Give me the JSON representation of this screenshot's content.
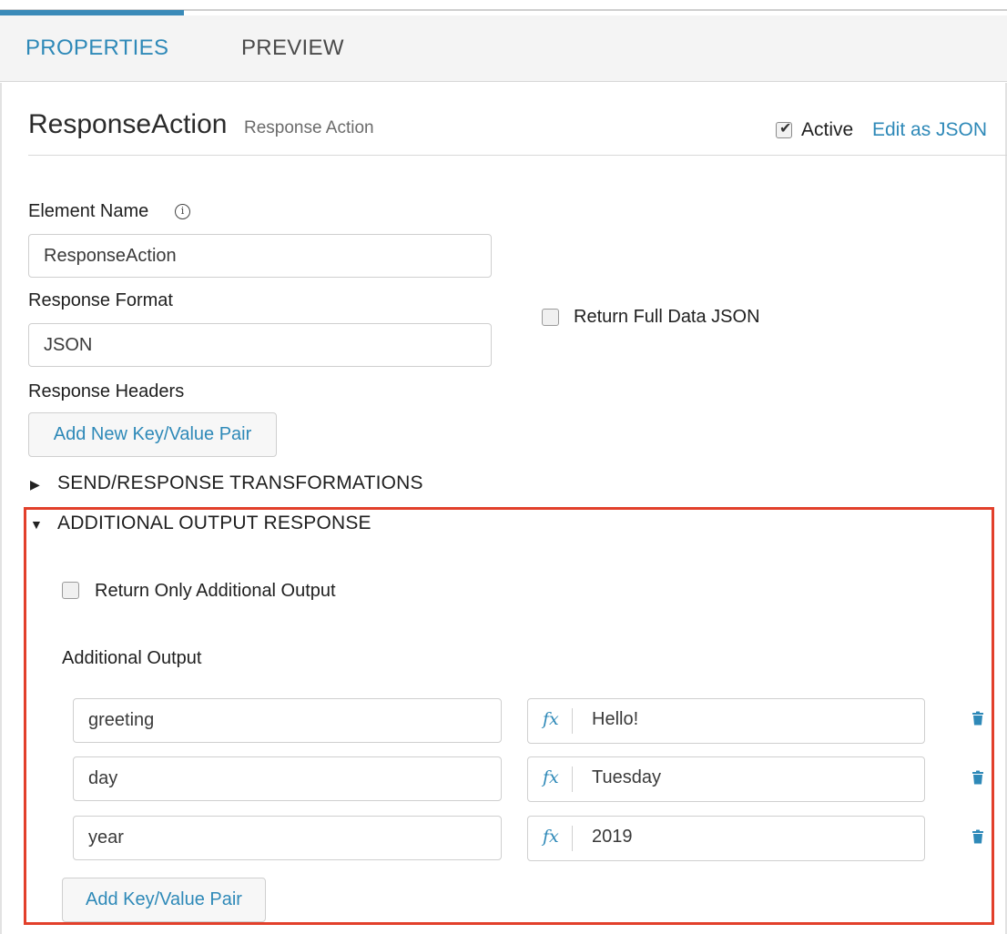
{
  "tabs": [
    {
      "label": "PROPERTIES",
      "active": true
    },
    {
      "label": "PREVIEW",
      "active": false
    }
  ],
  "header": {
    "title": "ResponseAction",
    "subtitle": "Response Action",
    "active_label": "Active",
    "active_checked": true,
    "edit_json_label": "Edit as JSON"
  },
  "form": {
    "element_name_label": "Element Name",
    "element_name_value": "ResponseAction",
    "response_format_label": "Response Format",
    "response_format_value": "JSON",
    "return_full_data_label": "Return Full Data JSON",
    "response_headers_label": "Response Headers",
    "add_new_pair_label": "Add New Key/Value Pair"
  },
  "sections": {
    "send_response_label": "SEND/RESPONSE TRANSFORMATIONS",
    "additional_output_response_label": "ADDITIONAL OUTPUT RESPONSE"
  },
  "additional": {
    "return_only_label": "Return Only Additional Output",
    "output_label": "Additional Output",
    "rows": [
      {
        "key": "greeting",
        "fx": "fx",
        "value": "Hello!"
      },
      {
        "key": "day",
        "fx": "fx",
        "value": "Tuesday"
      },
      {
        "key": "year",
        "fx": "fx",
        "value": "2019"
      }
    ],
    "add_pair_label": "Add Key/Value Pair"
  },
  "colors": {
    "accent": "#2e89b8",
    "highlight_border": "#e2402b"
  }
}
